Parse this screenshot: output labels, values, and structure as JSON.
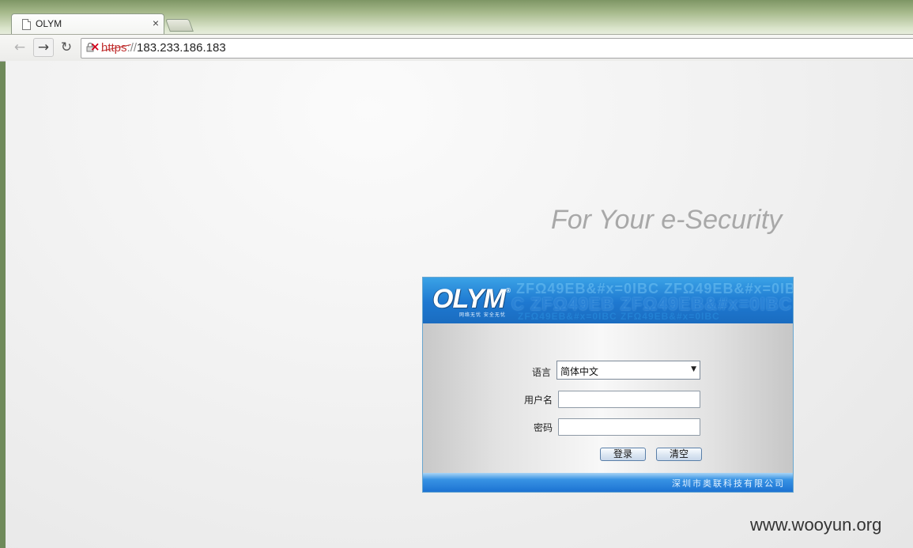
{
  "browser": {
    "tab_title": "OLYM",
    "tab_close": "×",
    "url_scheme": "https",
    "url_sep": "://",
    "url_host": "183.233.186.183",
    "back_icon": "arrow-left-icon",
    "forward_icon": "arrow-right-icon",
    "reload_icon": "reload-icon",
    "security_icon": "broken-lock-icon"
  },
  "page": {
    "slogan": "For Your e-Security",
    "site_watermark": "www.wooyun.org"
  },
  "login": {
    "logo": "OLYM",
    "logo_reg": "®",
    "logo_sub": "网络无忧  安全无忧",
    "header_watermark_1": "ZFΩ49EB&#x=0IBC ZFΩ49EB&#x=0IBC",
    "header_watermark_2": "C ZFΩ49EB ZFΩ49EB&#x=0IBC",
    "header_watermark_3": "ZFΩ49EB&#x=0IBC ZFΩ49EB&#x=0IBC",
    "language_label": "语言",
    "language_value": "简体中文",
    "username_label": "用户名",
    "username_value": "",
    "password_label": "密码",
    "password_value": "",
    "login_button": "登录",
    "clear_button": "清空",
    "company": "深圳市奥联科技有限公司"
  },
  "colors": {
    "header_blue": "#1e78d0",
    "footer_blue": "#1c72d2",
    "slogan_gray": "#a8a8a8",
    "url_error_red": "#c03030"
  }
}
